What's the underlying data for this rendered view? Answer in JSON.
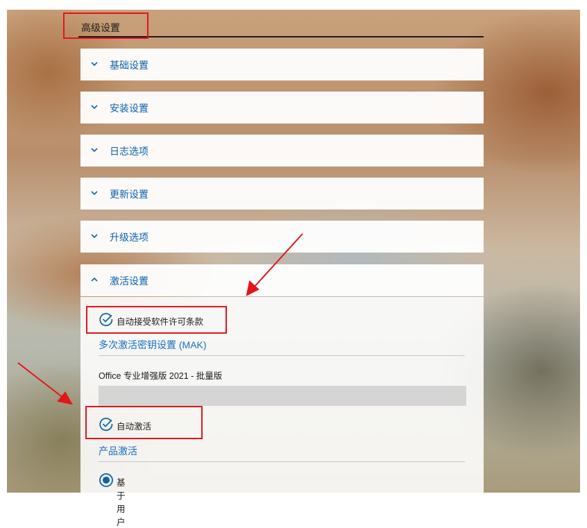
{
  "header": {
    "title": "高级设置"
  },
  "sections": [
    {
      "label": "基础设置",
      "expanded": false
    },
    {
      "label": "安装设置",
      "expanded": false
    },
    {
      "label": "日志选项",
      "expanded": false
    },
    {
      "label": "更新设置",
      "expanded": false
    },
    {
      "label": "升级选项",
      "expanded": false
    },
    {
      "label": "激活设置",
      "expanded": true
    }
  ],
  "activation": {
    "auto_accept_eula_label": "自动接受软件许可条款",
    "auto_accept_eula_checked": true,
    "mak_section_title": "多次激活密钥设置 (MAK)",
    "product_name": "Office 专业增强版 2021 - 批量版",
    "product_key_value": "",
    "auto_activate_label": "自动激活",
    "auto_activate_checked": true,
    "product_activation_title": "产品激活",
    "user_based_label": "基于用户",
    "user_based_selected": true
  },
  "colors": {
    "accent": "#0b62ad",
    "section_title": "#1a6ec2",
    "annotation_red": "#e3141a"
  },
  "icons": {
    "collapsed": "chevron-down-icon",
    "expanded": "chevron-up-icon",
    "checked": "check-circle-icon",
    "radio": "radio-selected-icon"
  }
}
